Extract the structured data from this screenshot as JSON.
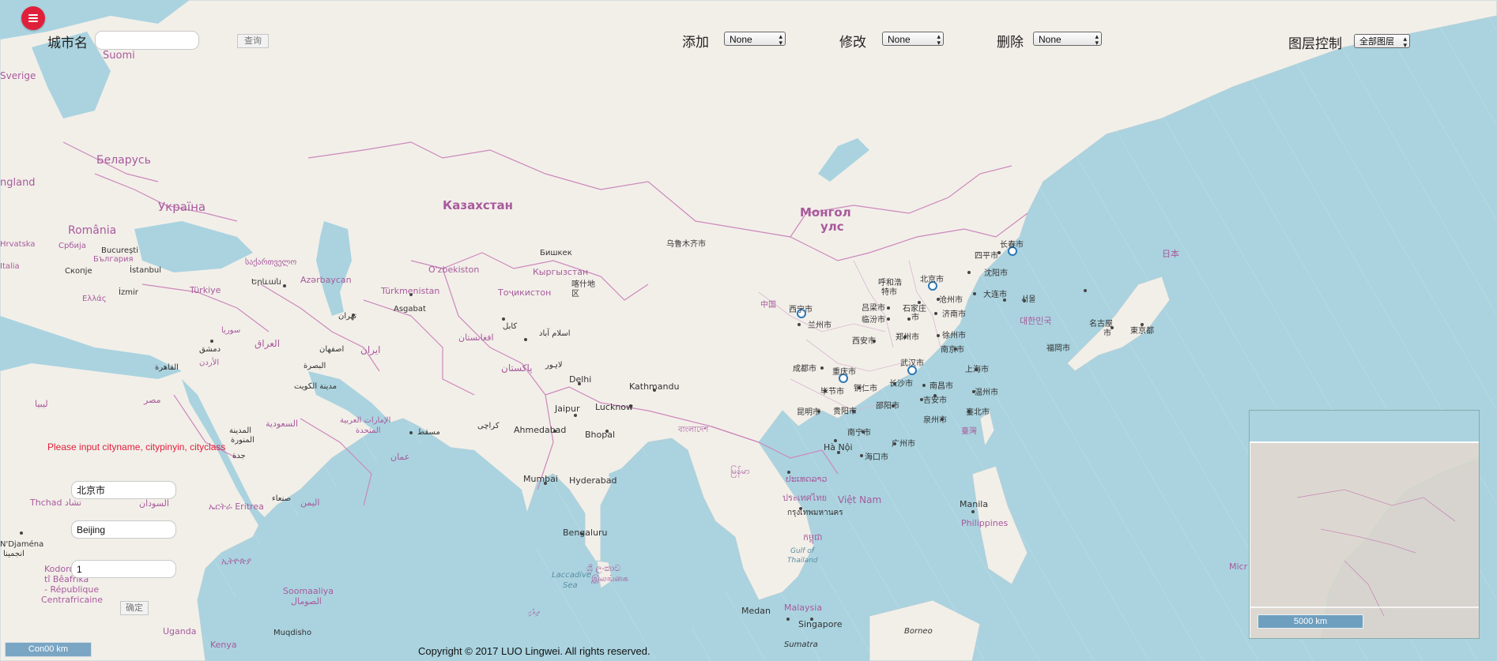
{
  "toolbar": {
    "city_label": "城市名",
    "search_button": "查询",
    "add_label": "添加",
    "add_value": "None",
    "edit_label": "修改",
    "edit_value": "None",
    "delete_label": "删除",
    "delete_value": "None",
    "layer_label": "图层控制",
    "layer_value": "全部图层"
  },
  "form": {
    "error": "Please input cityname, citypinyin, cityclass",
    "cityname": "北京市",
    "citypinyin": "Beijing",
    "cityclass": "1",
    "confirm": "确定"
  },
  "footer": {
    "copyright": "Copyright © 2017 LUO Lingwei. All rights reserved."
  },
  "scale": {
    "main": "Con00 km",
    "overview": "5000 km"
  },
  "colors": {
    "sea": "#aad3df",
    "land": "#f2efe9",
    "border": "#cc88bb",
    "label": "#a85a9c",
    "marker": "#2b78b5",
    "accent": "#e0203a"
  },
  "map_labels": {
    "suomi": "Suomi",
    "sverige": "Sverige",
    "england": "ngland",
    "belarus": "Беларусь",
    "ukraina": "Україна",
    "romania": "România",
    "hrvatska": "Hrvatska",
    "srbija": "Србија",
    "bulgaria": "България",
    "bucuresti": "București",
    "istanbul": "İstanbul",
    "italia": "Italia",
    "skopje": "Скопје",
    "ellas": "Ελλάς",
    "izmir": "İzmir",
    "turkiye": "Türkiye",
    "sakartvelo": "საქართველო",
    "yerevan": "Երևան",
    "azerbaycan": "Azərbaycan",
    "kazakhstan": "Казахстан",
    "mongol1": "Монгол",
    "mongol2": "улс",
    "bishkek": "Бишкек",
    "uzbekiston": "O'zbekiston",
    "kyrgyzstan": "Кыргызстан",
    "turkmenistan": "Türkmenistan",
    "ashgabat": "Asgabat",
    "tojikiston": "Тоҷикистон",
    "kashgar1": "喀什地",
    "kashgar2": "区",
    "tehran": "تهران",
    "iran": "ایران",
    "iraq": "العراق",
    "suriya": "سوريا",
    "dimashq": "دمشق",
    "urdun": "الأردن",
    "esfahan": "اصفهان",
    "afghanistan": "افغانستان",
    "kabul": "كابل",
    "islamabad": "اسلام آباد",
    "pakistan": "پاکستان",
    "lahore": "لاہور",
    "delhi": "Delhi",
    "kathmandu": "Kathmandu",
    "jaipur": "Jaipur",
    "lucknow": "Lucknow",
    "ahmedabad": "Ahmedabad",
    "bhopal": "Bhopal",
    "mumbai": "Mumbai",
    "hyderabad": "Hyderabad",
    "bengaluru": "Bengaluru",
    "karachi": "كراچی",
    "qahira": "القاهرة",
    "misr": "مصر",
    "libya": "ليبيا",
    "saudi": "السعودية",
    "kuwait": "مدينة الكويت",
    "basra": "البصرة",
    "uae1": "الإمارات العربية",
    "uae2": "المتحدة",
    "muscat": "مسقط",
    "oman": "عمان",
    "madinah1": "المدينة",
    "madinah2": "المنورة",
    "jeddah": "جدة",
    "yemen": "اليمن",
    "sanaa": "صنعاء",
    "sudan": "السودان",
    "eritrea": "ኤርትራ Eritrea",
    "chad": "Thchad تشاد",
    "ndjamena": "N'Djaména",
    "anjamina": "انجمينا",
    "ethiopia": "ኢትዮጵያ",
    "kodoro1": "Kodoro",
    "kodoro2": "tî Bêafrîka",
    "kodoro3": "- République",
    "kodoro4": "Centrafricaine",
    "soomaaliya": "Soomaaliya",
    "somal": "الصومال",
    "uganda": "Uganda",
    "kenya": "Kenya",
    "muqdisho": "Muqdisho",
    "lanka1": "ශ්‍රී ලංකාව",
    "lanka2": "இலங்கை",
    "laccadive1": "Laccadive",
    "laccadive2": "Sea",
    "maldives": "ދިވެހި",
    "bangladesh": "বাংলাদেশ",
    "myanmar": "မြန်မာ",
    "thailand": "ประเทศไทย",
    "bangkok": "กรุงเทพมหานคร",
    "cambodia": "កម្ពុជា",
    "gulf1": "Gulf of",
    "gulf2": "Thailand",
    "vietnam": "Việt Nam",
    "laos": "ປະເທດລາວ",
    "hanoi": "Hà Nội",
    "medan": "Medan",
    "malaysia": "Malaysia",
    "singapore": "Singapore",
    "sumatra": "Sumatra",
    "borneo": "Borneo",
    "manila": "Manila",
    "philippines": "Philippines",
    "taiwan": "臺灣",
    "taipei": "臺北市",
    "china": "中国",
    "xining": "西宁市",
    "lanzhou": "兰州市",
    "beijing": "北京市",
    "hohhot1": "呼和浩",
    "hohhot2": "特市",
    "shijiazhuang1": "石家庄",
    "shijiazhuang2": "市",
    "lvliang": "吕梁市",
    "linfen": "临汾市",
    "cangzhou": "沧州市",
    "jinan": "济南市",
    "dalian": "大连市",
    "shenyang": "沈阳市",
    "siping": "四平市",
    "changchun": "长春市",
    "xian": "西安市",
    "zhengzhou": "郑州市",
    "xuzhou": "徐州市",
    "nanjing": "南京市",
    "shanghai": "上海市",
    "wuhan": "武汉市",
    "chengdu": "成都市",
    "chongqing": "重庆市",
    "bijie": "毕节市",
    "tongren": "铜仁市",
    "changsha": "长沙市",
    "nanchang": "南昌市",
    "kunming": "昆明市",
    "guiyang": "贵阳市",
    "shaoyang": "邵阳市",
    "jian": "吉安市",
    "wenzhou": "温州市",
    "quanzhou": "泉州市",
    "nanning": "南宁市",
    "guangzhou": "广州市",
    "haikou": "海口市",
    "seoul": "서울",
    "korea": "대한민국",
    "nippon": "日本",
    "nagoya1": "名古屋",
    "nagoya2": "市",
    "tokyo": "東京都",
    "fukuoka": "福岡市",
    "micr": "Micr",
    "wulumuqi": "乌鲁木齐市"
  }
}
